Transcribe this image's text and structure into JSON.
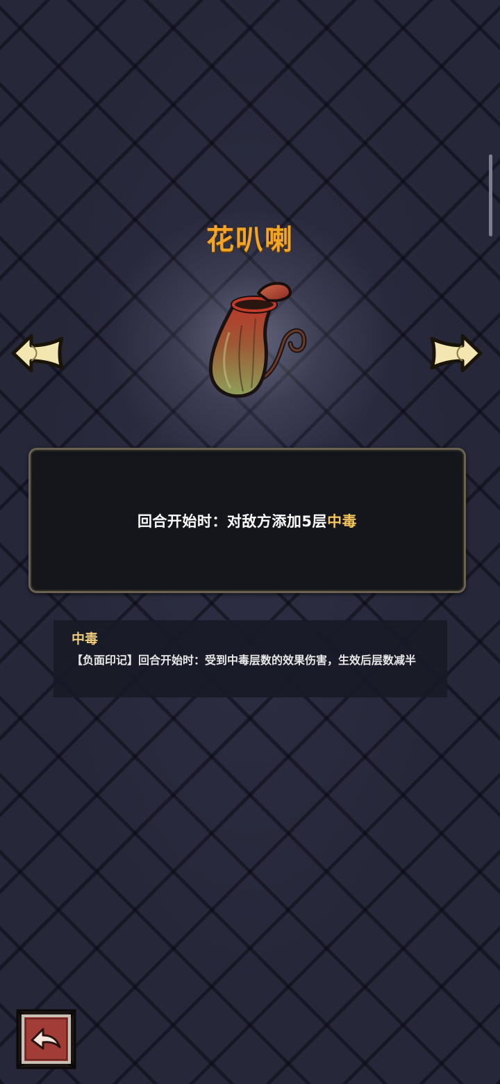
{
  "item": {
    "name": "花叭喇",
    "image_icon": "pitcher-plant-icon"
  },
  "effect": {
    "prefix": "回合开始时：对敌方添加5层",
    "keyword": "中毒"
  },
  "tooltip": {
    "title": "中毒",
    "description": "【负面印记】回合开始时：受到中毒层数的效果伤害，生效后层数减半"
  },
  "nav": {
    "prev_icon": "arrow-left-icon",
    "next_icon": "arrow-right-icon",
    "back_icon": "return-icon"
  },
  "colors": {
    "title": "#f2a628",
    "keyword": "#f6c65b",
    "tooltip_title": "#eecb7b",
    "background": "#262739",
    "back_button": "#9a3a35"
  }
}
